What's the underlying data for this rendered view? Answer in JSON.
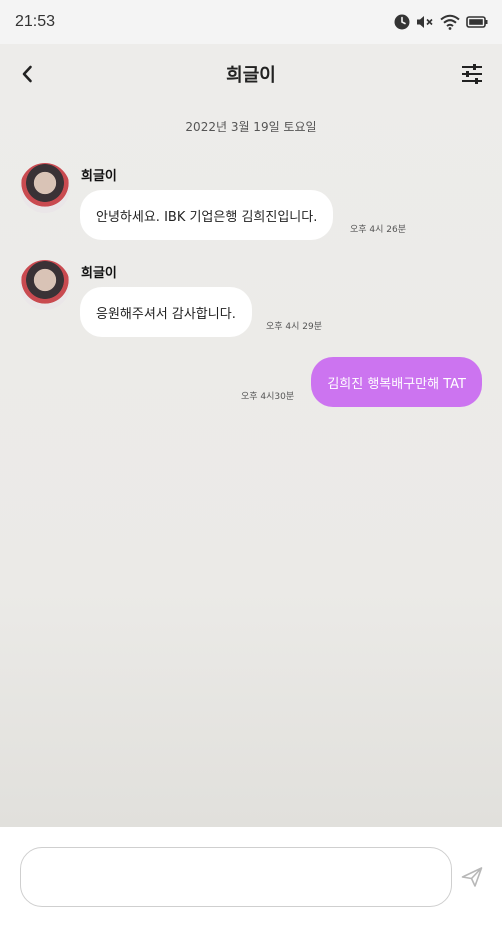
{
  "status_bar": {
    "time": "21:53",
    "icons": [
      "clock-icon",
      "mute-icon",
      "wifi-icon",
      "battery-icon"
    ]
  },
  "header": {
    "title": "희글이",
    "icons": [
      "back-icon",
      "settings-sliders-icon"
    ]
  },
  "chat": {
    "date": "2022년 3월 19일 토요일",
    "messages": [
      {
        "direction": "incoming",
        "sender": "희글이",
        "text": "안녕하세요. IBK 기업은행 김희진입니다.",
        "time": "오후 4시 26분"
      },
      {
        "direction": "incoming",
        "sender": "희글이",
        "text": "응원해주셔서 감사합니다.",
        "time": "오후 4시 29분"
      },
      {
        "direction": "outgoing",
        "text": "김희진 행복배구만해 TAT",
        "time": "오후 4시30분"
      }
    ]
  },
  "composer": {
    "value": "",
    "placeholder": "",
    "send_icon": "send-icon"
  },
  "colors": {
    "outgoing_bubble": "#cc74f0",
    "incoming_bubble": "#ffffff",
    "chat_background": "#edecea"
  }
}
